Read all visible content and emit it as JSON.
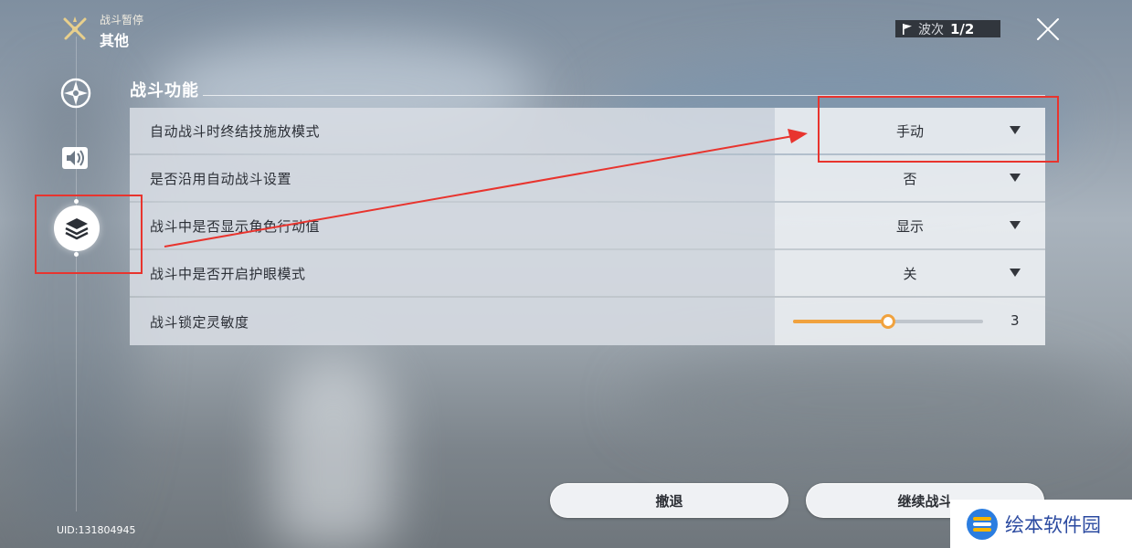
{
  "header": {
    "subtitle": "战斗暂停",
    "title": "其他",
    "wave_label": "波次",
    "wave_value": "1/2",
    "icon": "crossed-swords-icon"
  },
  "sidebar": {
    "items": [
      {
        "name": "combat-settings",
        "icon": "compass-icon",
        "selected": false
      },
      {
        "name": "audio-settings",
        "icon": "speaker-icon",
        "selected": false
      },
      {
        "name": "other-settings",
        "icon": "layers-icon",
        "selected": true
      }
    ]
  },
  "section": {
    "title": "战斗功能"
  },
  "settings": [
    {
      "label": "自动战斗时终结技施放模式",
      "value": "手动",
      "type": "dropdown"
    },
    {
      "label": "是否沿用自动战斗设置",
      "value": "否",
      "type": "dropdown"
    },
    {
      "label": "战斗中是否显示角色行动值",
      "value": "显示",
      "type": "dropdown"
    },
    {
      "label": "战斗中是否开启护眼模式",
      "value": "关",
      "type": "dropdown"
    },
    {
      "label": "战斗锁定灵敏度",
      "value": "3",
      "type": "slider",
      "level": 0.5
    }
  ],
  "buttons": {
    "retreat": "撤退",
    "continue": "继续战斗"
  },
  "uid": "UID:131804945",
  "watermark": {
    "text": "绘本软件园"
  },
  "colors": {
    "accent": "#f0a23e",
    "annotation": "#e8342e",
    "watermark_blue": "#2b4aa0"
  }
}
